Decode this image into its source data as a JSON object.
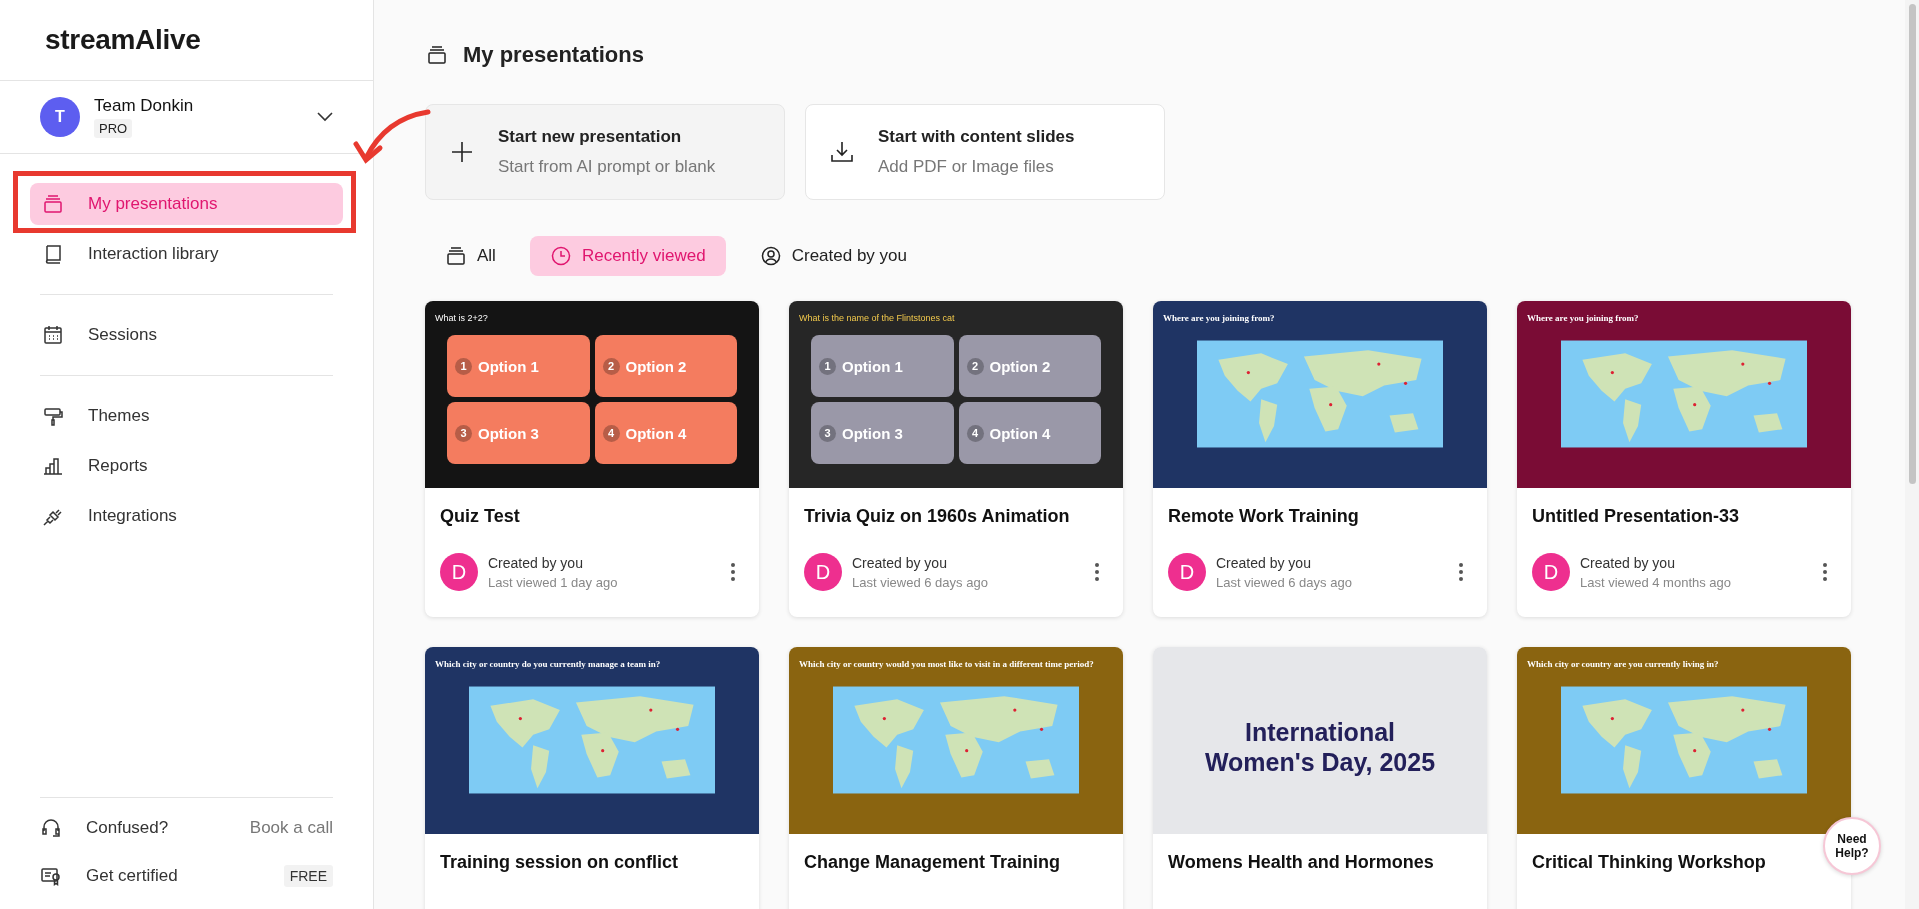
{
  "sidebar": {
    "logo": "streamAlive",
    "team": {
      "initial": "T",
      "name": "Team Donkin",
      "plan": "PRO"
    },
    "nav_groups": [
      [
        {
          "label": "My presentations",
          "selected": true
        },
        {
          "label": "Interaction library",
          "selected": false
        }
      ],
      [
        {
          "label": "Sessions",
          "selected": false
        }
      ],
      [
        {
          "label": "Themes",
          "selected": false
        },
        {
          "label": "Reports",
          "selected": false
        },
        {
          "label": "Integrations",
          "selected": false
        }
      ]
    ],
    "footer": [
      {
        "label": "Confused?",
        "kind": "link",
        "extra": "Book a call"
      },
      {
        "label": "Get certified",
        "kind": "badge",
        "extra": "FREE"
      }
    ]
  },
  "main": {
    "title": "My presentations",
    "actions": [
      {
        "title": "Start new presentation",
        "subtitle": "Start from AI prompt or blank"
      },
      {
        "title": "Start with content slides",
        "subtitle": "Add PDF or Image files"
      }
    ],
    "filters": [
      {
        "label": "All",
        "selected": false
      },
      {
        "label": "Recently viewed",
        "selected": true
      },
      {
        "label": "Created by you",
        "selected": false
      }
    ],
    "presentations": [
      {
        "title": "Quiz Test",
        "creator": "Created by you",
        "viewed": "Last viewed 1 day ago",
        "avatar": "D",
        "slide": {
          "kind": "quiz",
          "color": "#141414",
          "question": "What is 2+2?",
          "options": [
            {
              "number": "1",
              "label": "Option 1",
              "color": "#f47c5f"
            },
            {
              "number": "2",
              "label": "Option 2",
              "color": "#f47c5f"
            },
            {
              "number": "3",
              "label": "Option 3",
              "color": "#f47c5f"
            },
            {
              "number": "4",
              "label": "Option 4",
              "color": "#f47c5f"
            }
          ]
        }
      },
      {
        "title": "Trivia Quiz on 1960s Animation",
        "creator": "Created by you",
        "viewed": "Last viewed 6 days ago",
        "avatar": "D",
        "slide": {
          "kind": "quiz",
          "color": "#262626",
          "question": "What is the name of the Flintstones cat",
          "options": [
            {
              "number": "1",
              "label": "Option 1",
              "color": "#9a98a8"
            },
            {
              "number": "2",
              "label": "Option 2",
              "color": "#9a98a8"
            },
            {
              "number": "3",
              "label": "Option 3",
              "color": "#9a98a8"
            },
            {
              "number": "4",
              "label": "Option 4",
              "color": "#9a98a8"
            }
          ]
        }
      },
      {
        "title": "Remote Work Training",
        "creator": "Created by you",
        "viewed": "Last viewed 6 days ago",
        "avatar": "D",
        "slide": {
          "kind": "map",
          "color": "#1f3464",
          "question": "Where are you joining from?"
        }
      },
      {
        "title": "Untitled Presentation-33",
        "creator": "Created by you",
        "viewed": "Last viewed 4 months ago",
        "avatar": "D",
        "slide": {
          "kind": "map",
          "color": "#7a0c35",
          "question": "Where are you joining from?"
        }
      },
      {
        "title": "Training session on conflict",
        "slide": {
          "kind": "map",
          "color": "#1f3464",
          "question": "Which city or country do you currently manage a team in?"
        }
      },
      {
        "title": "Change Management Training",
        "slide": {
          "kind": "map",
          "color": "#8a6410",
          "question": "Which city or country would you most like to visit in a different time period?"
        }
      },
      {
        "title": "Womens Health and Hormones",
        "slide": {
          "kind": "title",
          "color": "#e6e7ea",
          "question": "International Women's Day, 2025"
        }
      },
      {
        "title": "Critical Thinking Workshop",
        "slide": {
          "kind": "map",
          "color": "#8a6410",
          "question": "Which city or country are you currently living in?"
        }
      }
    ]
  },
  "help_button": "Need Help?"
}
